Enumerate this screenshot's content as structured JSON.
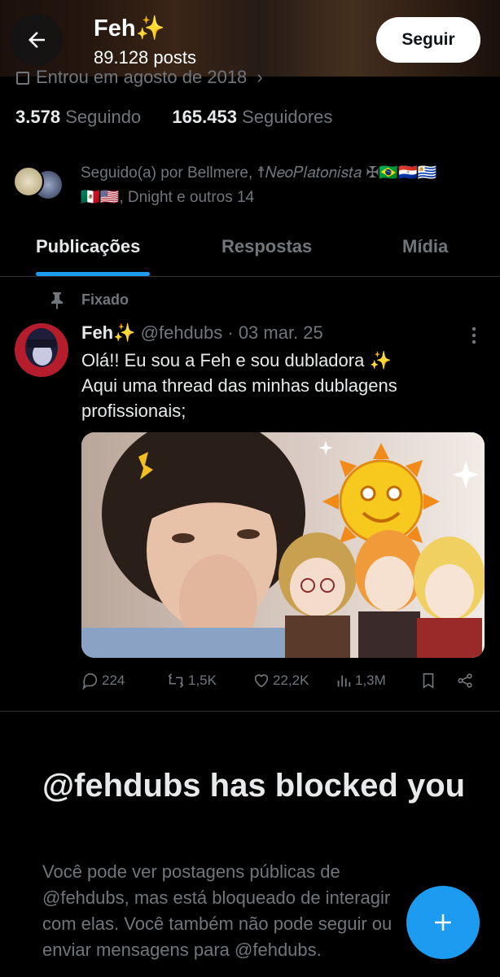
{
  "header": {
    "name": "Feh✨",
    "posts_count": "89.128 posts",
    "follow_label": "Seguir"
  },
  "profile": {
    "joined": "Entrou em agosto de 2018",
    "following_count": "3.578",
    "following_label": "Seguindo",
    "followers_count": "165.453",
    "followers_label": "Seguidores",
    "followed_by_line1": "Seguido(a) por Bellmere, ☨𝑁𝑒𝑜𝑃𝑙𝑎𝑡𝑜𝑛𝑖𝑠𝑡𝑎 ✠🇧🇷🇵🇾🇺🇾",
    "followed_by_line2": "🇲🇽🇺🇸, Dnight e outros 14"
  },
  "tabs": [
    {
      "label": "Publicações",
      "active": true
    },
    {
      "label": "Respostas",
      "active": false
    },
    {
      "label": "Mídia",
      "active": false
    }
  ],
  "pinned_post": {
    "pinned_label": "Fixado",
    "author_name": "Feh✨",
    "meta": "@fehdubs · 03 mar. 25",
    "text_line1": "Olá!! Eu sou a Feh e sou dubladora ✨",
    "text_line2": "Aqui uma thread das minhas dublagens profissionais;",
    "replies": "224",
    "reposts": "1,5K",
    "likes": "22,2K",
    "views": "1,3M"
  },
  "blocked": {
    "title": "@fehdubs has blocked you",
    "description": "Você pode ver postagens públicas de @fehdubs, mas está bloqueado de interagir com elas. Você também não pode seguir ou enviar mensagens para @fehdubs."
  },
  "colors": {
    "accent": "#1d9bf0",
    "muted": "#71767b",
    "text": "#e7e9ea",
    "background": "#000000"
  },
  "icons": [
    "back-arrow-icon",
    "calendar-icon",
    "pin-icon",
    "more-icon",
    "reply-icon",
    "repost-icon",
    "like-icon",
    "views-icon",
    "bookmark-icon",
    "share-icon",
    "plus-icon"
  ]
}
